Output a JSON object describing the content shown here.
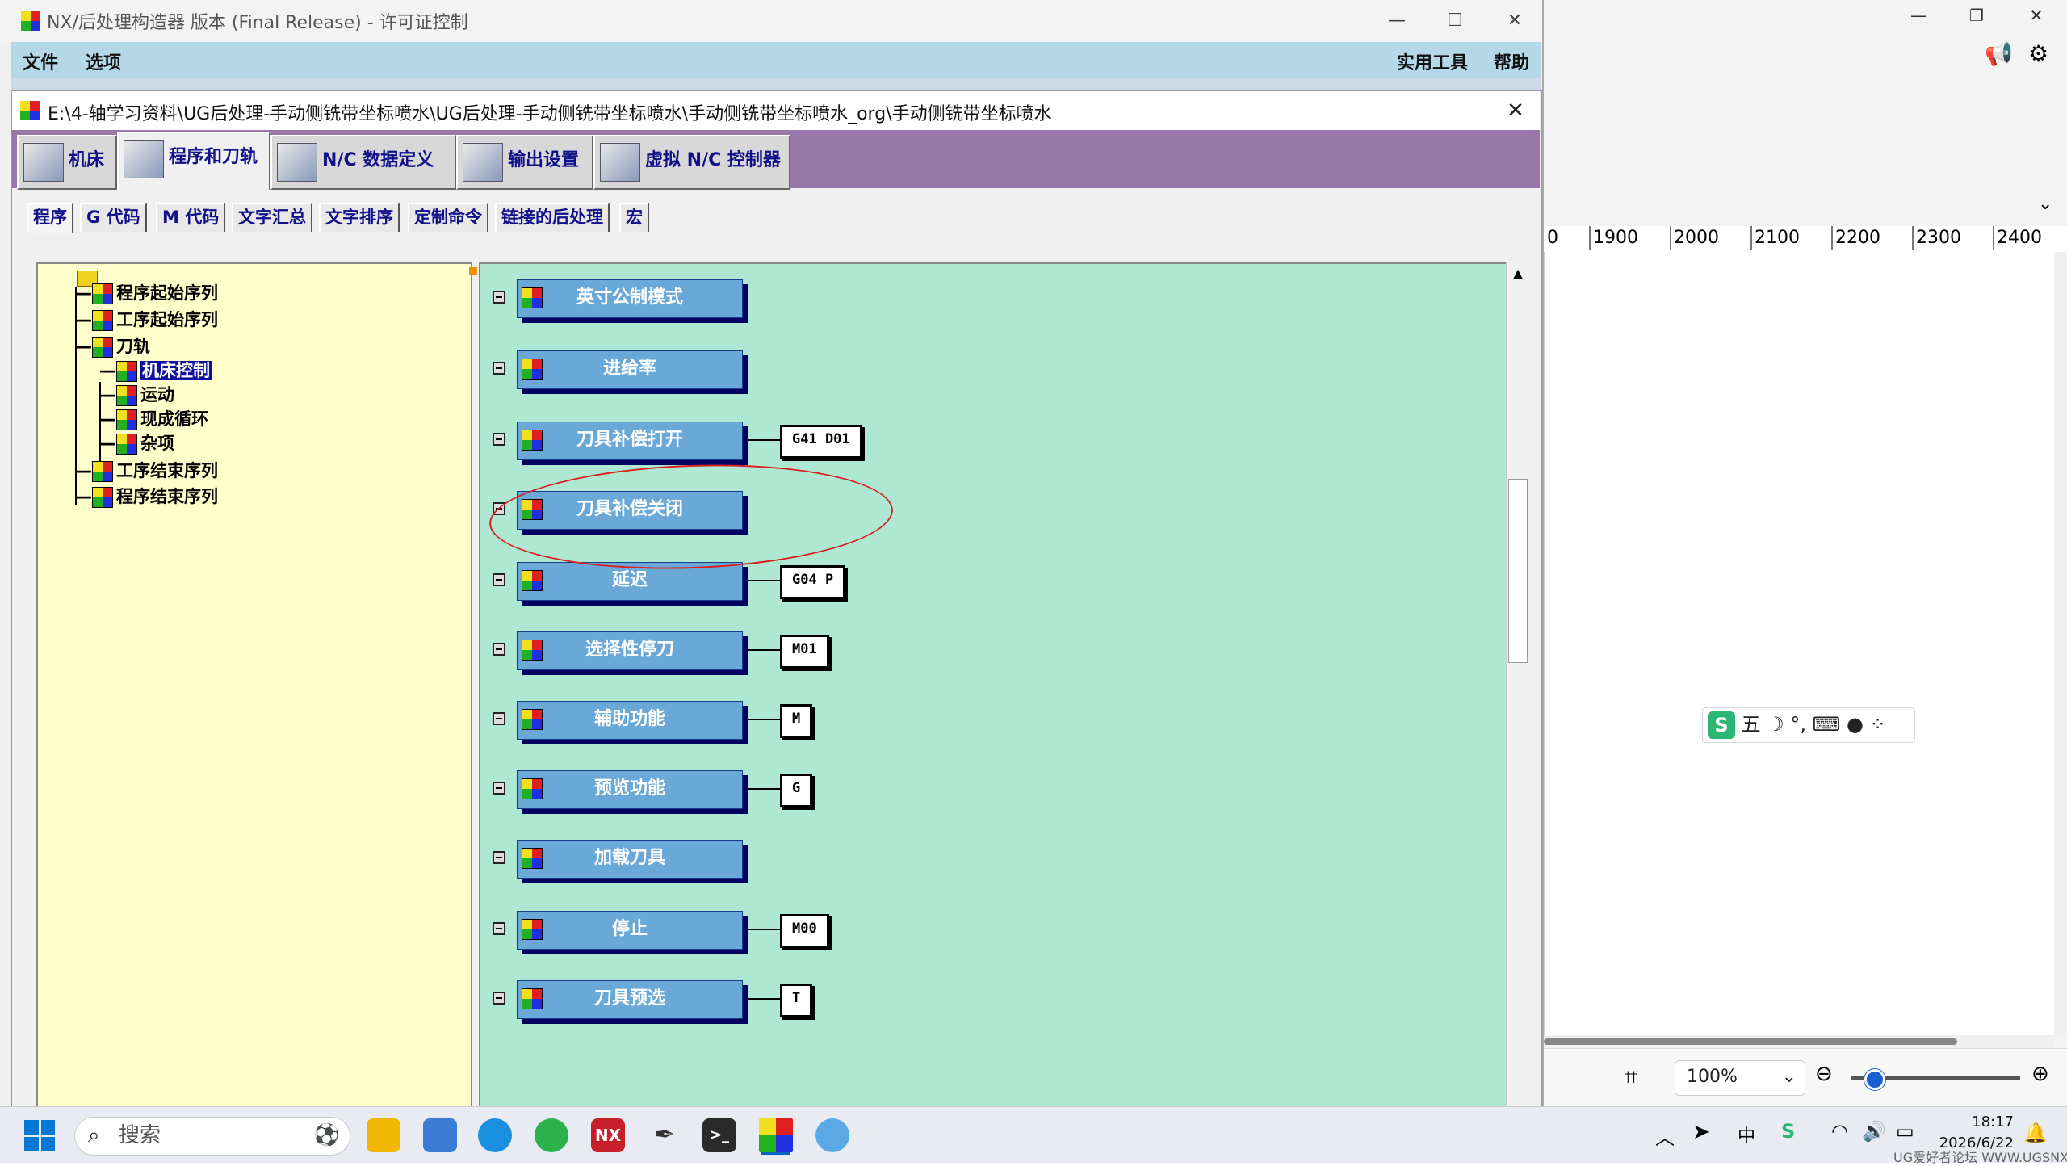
{
  "main_window": {
    "title": "NX/后处理构造器 版本 (Final Release) - 许可证控制",
    "menus_left": [
      "文件",
      "选项"
    ],
    "menus_right": [
      "实用工具",
      "帮助"
    ],
    "controls": {
      "minimize": "—",
      "maximize": "☐",
      "close": "✕"
    }
  },
  "inner_window": {
    "path": "E:\\4-轴学习资料\\UG后处理-手动侧铣带坐标喷水\\UG后处理-手动侧铣带坐标喷水\\手动侧铣带坐标喷水_org\\手动侧铣带坐标喷水",
    "close": "✕"
  },
  "main_tabs": [
    {
      "label": "机床",
      "active": false
    },
    {
      "label": "程序和刀轨",
      "active": true
    },
    {
      "label": "N/C 数据定义",
      "active": false
    },
    {
      "label": "输出设置",
      "active": false
    },
    {
      "label": "虚拟 N/C 控制器",
      "active": false
    }
  ],
  "sub_tabs": [
    {
      "label": "程序",
      "active": true
    },
    {
      "label": "G 代码",
      "active": false
    },
    {
      "label": "M 代码",
      "active": false
    },
    {
      "label": "文字汇总",
      "active": false
    },
    {
      "label": "文字排序",
      "active": false
    },
    {
      "label": "定制命令",
      "active": false
    },
    {
      "label": "链接的后处理",
      "active": false
    },
    {
      "label": "宏",
      "active": false
    }
  ],
  "tree": [
    {
      "label": "程序起始序列",
      "level": 1
    },
    {
      "label": "工序起始序列",
      "level": 1
    },
    {
      "label": "刀轨",
      "level": 1
    },
    {
      "label": "机床控制",
      "level": 2,
      "selected": true
    },
    {
      "label": "运动",
      "level": 2
    },
    {
      "label": "现成循环",
      "level": 2
    },
    {
      "label": "杂项",
      "level": 2
    },
    {
      "label": "工序结束序列",
      "level": 1
    },
    {
      "label": "程序结束序列",
      "level": 1
    }
  ],
  "blocks": [
    {
      "label": "英寸公制模式",
      "code": ""
    },
    {
      "label": "进给率",
      "code": ""
    },
    {
      "label": "刀具补偿打开",
      "code": "G41 D01"
    },
    {
      "label": "刀具补偿关闭",
      "code": ""
    },
    {
      "label": "延迟",
      "code": "G04 P"
    },
    {
      "label": "选择性停刀",
      "code": "M01"
    },
    {
      "label": "辅助功能",
      "code": "M"
    },
    {
      "label": "预览功能",
      "code": "G"
    },
    {
      "label": "加载刀具",
      "code": ""
    },
    {
      "label": "停止",
      "code": "M00"
    },
    {
      "label": "刀具预选",
      "code": "T"
    }
  ],
  "background_app": {
    "ruler_ticks": [
      "0",
      "1900",
      "2000",
      "2100",
      "2200",
      "2300",
      "2400"
    ],
    "zoom": "100%",
    "ime": "五 ☽ °, ⌨ ● ⁘"
  },
  "taskbar": {
    "search_placeholder": "搜索",
    "nx_label": "NX",
    "ime_lang": "中",
    "time": "18:17",
    "date": "2026/6/22"
  },
  "watermark": "UG爱好者论坛 WWW.UGSNX.COM"
}
